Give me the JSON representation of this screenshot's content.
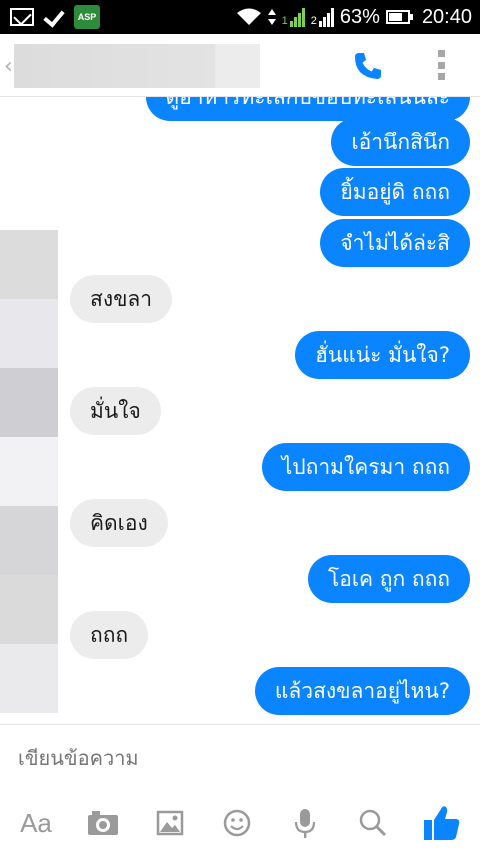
{
  "status_bar": {
    "battery": "63%",
    "time": "20:40",
    "asp_label": "ASP",
    "sim1": "1",
    "sim2": "2"
  },
  "header": {
    "contact_name": "",
    "icons": [
      "back-icon",
      "phone-icon",
      "more-icon"
    ]
  },
  "messages": [
    {
      "side": "out",
      "text": "ดูอาหารทะเลกับขอบทะเลนั่นละ"
    },
    {
      "side": "out",
      "text": "เอ้านึกสินึก"
    },
    {
      "side": "out",
      "text": "ยิ้มอยู่ดิ ถถถ"
    },
    {
      "side": "out",
      "text": "จำไม่ได้ล่ะสิ"
    },
    {
      "side": "in",
      "text": "สงขลา"
    },
    {
      "side": "out",
      "text": "ฮั่นแน่ะ มั่นใจ?"
    },
    {
      "side": "in",
      "text": "มั่นใจ"
    },
    {
      "side": "out",
      "text": "ไปถามใครมา ถถถ"
    },
    {
      "side": "in",
      "text": "คิดเอง"
    },
    {
      "side": "out",
      "text": "โอเค ถูก ถถถ"
    },
    {
      "side": "in",
      "text": "ถถถ"
    },
    {
      "side": "out",
      "text": "แล้วสงขลาอยู่ไหน?"
    }
  ],
  "composer": {
    "placeholder": "เขียนข้อความ",
    "aa_label": "Aa",
    "toolbar_icons": [
      "text-format-icon",
      "camera-icon",
      "gallery-icon",
      "emoji-icon",
      "microphone-icon",
      "search-icon",
      "thumbs-up-icon"
    ]
  },
  "colors": {
    "outgoing_bubble": "#0a84ff",
    "incoming_bubble": "#ececec",
    "accent": "#0a84ff"
  }
}
